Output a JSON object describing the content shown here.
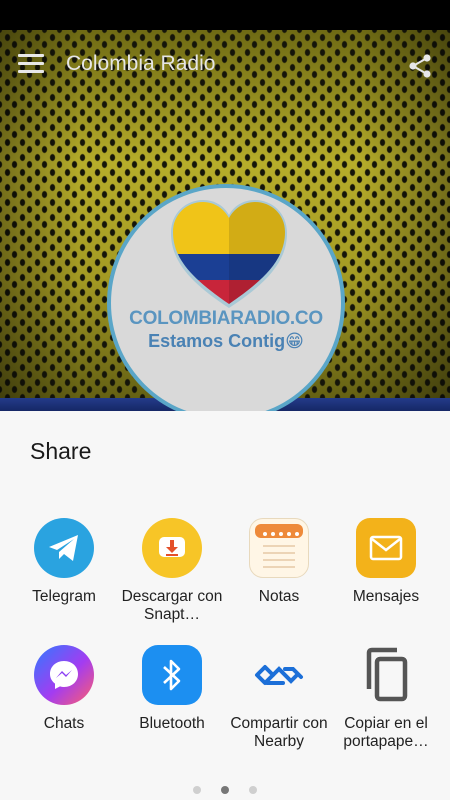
{
  "app": {
    "title": "Colombia Radio",
    "logo_line1": "COLOMBIARADIO.CO",
    "logo_line2": "Estamos Contig😁"
  },
  "share_sheet": {
    "title": "Share",
    "targets": [
      {
        "label": "Telegram",
        "icon": "telegram-icon",
        "color": "#2aa3e0"
      },
      {
        "label": "Descargar con Snapt…",
        "icon": "snaptube-download-icon",
        "color": "#f7c527"
      },
      {
        "label": "Notas",
        "icon": "notes-icon",
        "color": "#f1a04a"
      },
      {
        "label": "Mensajes",
        "icon": "messages-icon",
        "color": "#f3b21a"
      },
      {
        "label": "Chats",
        "icon": "messenger-icon",
        "color": "#8a3cf4"
      },
      {
        "label": "Bluetooth",
        "icon": "bluetooth-icon",
        "color": "#1c8ff1"
      },
      {
        "label": "Compartir con Nearby",
        "icon": "nearby-share-icon",
        "color": "#1c6fd8"
      },
      {
        "label": "Copiar en el portapape…",
        "icon": "copy-icon",
        "color": "#555555"
      }
    ],
    "pager": {
      "page_count": 3,
      "active_page": 2
    }
  }
}
